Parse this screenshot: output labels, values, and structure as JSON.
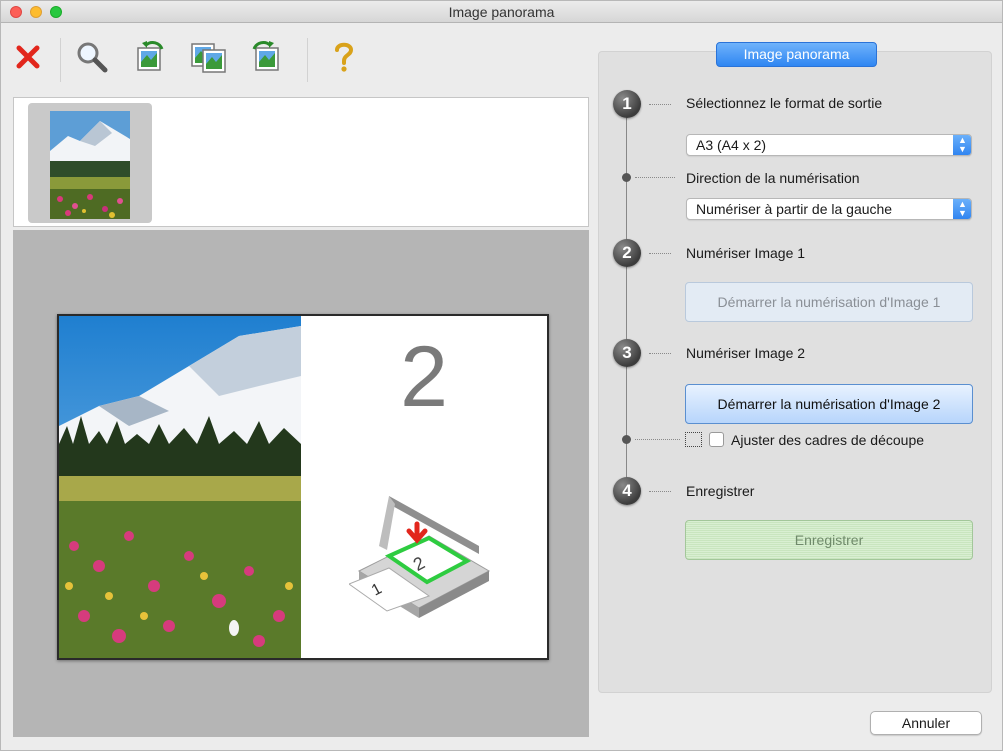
{
  "window": {
    "title": "Image panorama"
  },
  "toolbar": {
    "items": [
      {
        "name": "delete-icon"
      },
      {
        "name": "zoom-icon"
      },
      {
        "name": "rotate-left-icon"
      },
      {
        "name": "swap-icon"
      },
      {
        "name": "rotate-right-icon"
      },
      {
        "name": "help-icon"
      }
    ]
  },
  "preview": {
    "page_number": "2"
  },
  "panel": {
    "tab_label": "Image panorama",
    "steps": [
      {
        "number": "1",
        "label": "Sélectionnez le format de sortie"
      },
      {
        "number": "2",
        "label": "Numériser Image 1"
      },
      {
        "number": "3",
        "label": "Numériser Image 2"
      },
      {
        "number": "4",
        "label": "Enregistrer"
      }
    ],
    "output_format": {
      "value": "A3 (A4 x 2)"
    },
    "direction": {
      "label": "Direction de la numérisation",
      "value": "Numériser à partir de la gauche"
    },
    "scan1_button": "Démarrer la numérisation d'Image 1",
    "scan2_button": "Démarrer la numérisation d'Image 2",
    "crop_checkbox": {
      "label": "Ajuster des cadres de découpe",
      "checked": false
    },
    "save_button": "Enregistrer"
  },
  "footer": {
    "cancel_label": "Annuler"
  },
  "colors": {
    "accent": "#2f86f2",
    "delete": "#e2261c",
    "scan_frame": "#2ecc40"
  }
}
